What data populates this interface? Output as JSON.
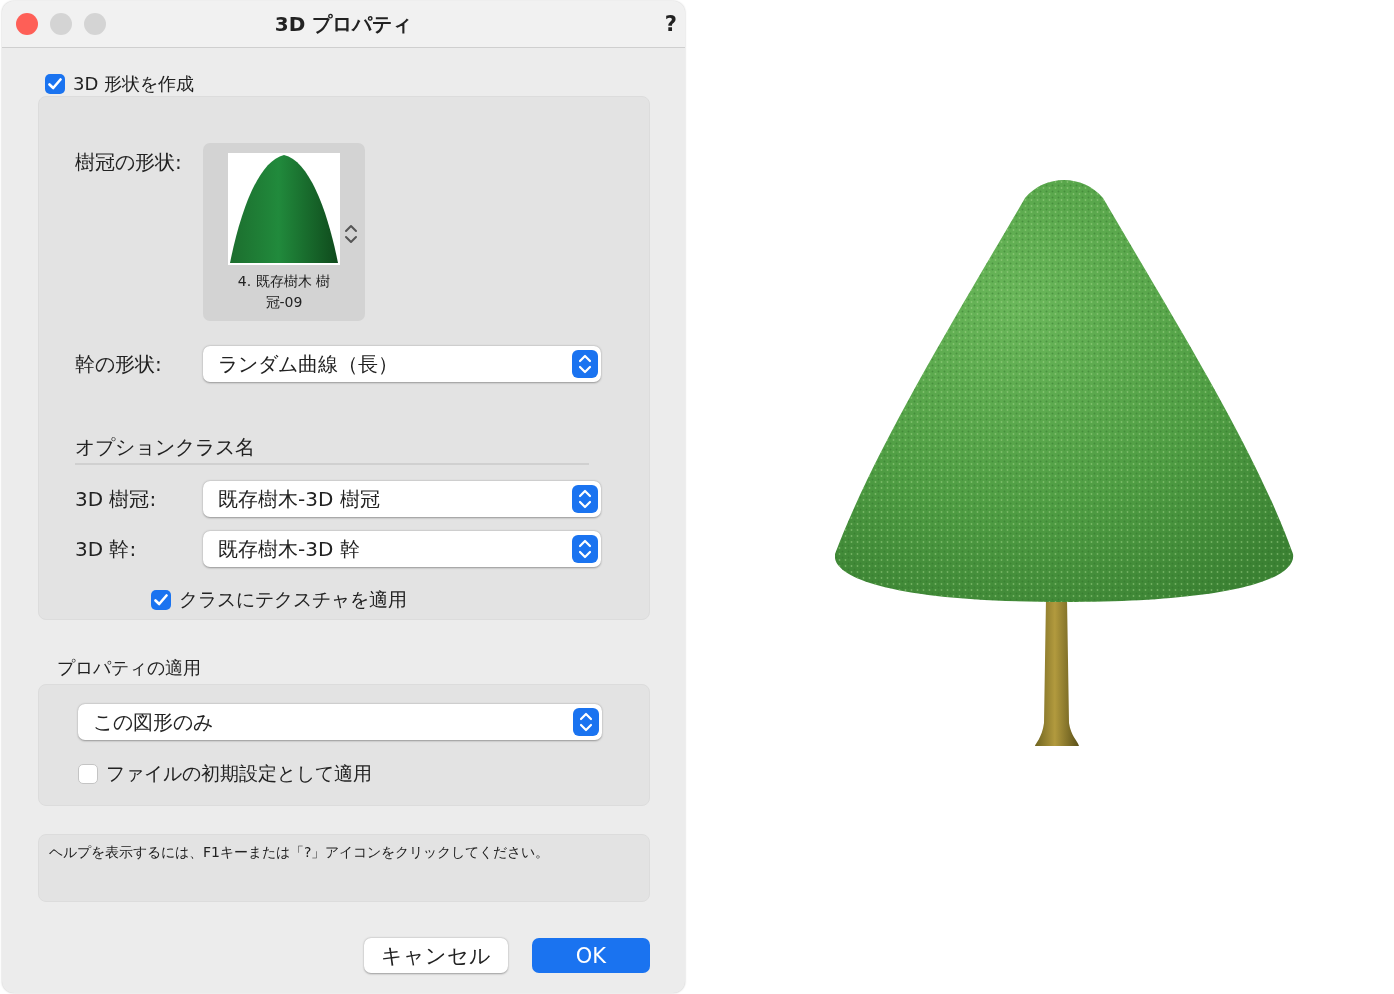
{
  "window": {
    "title": "3D プロパティ",
    "help": "?"
  },
  "create_3d": {
    "label": "3D 形状を作成",
    "checked": true
  },
  "crown_shape": {
    "label": "樹冠の形状:",
    "caption": "4. 既存樹木 樹冠-09"
  },
  "trunk_shape": {
    "label": "幹の形状:",
    "value": "ランダム曲線（長）"
  },
  "option_classes": {
    "heading": "オプションクラス名",
    "rows": [
      {
        "label": "3D 樹冠:",
        "value": "既存樹木-3D 樹冠"
      },
      {
        "label": "3D 幹:",
        "value": "既存樹木-3D 幹"
      }
    ],
    "apply_texture": {
      "label": "クラスにテクスチャを適用",
      "checked": true
    }
  },
  "apply_properties": {
    "heading": "プロパティの適用",
    "value": "この図形のみ",
    "file_default": {
      "label": "ファイルの初期設定として適用",
      "checked": false
    }
  },
  "help_text": "ヘルプを表示するには、F1キーまたは「?」アイコンをクリックしてください。",
  "buttons": [
    {
      "label": "キャンセル",
      "kind": "secondary"
    },
    {
      "label": "OK",
      "kind": "primary"
    }
  ]
}
